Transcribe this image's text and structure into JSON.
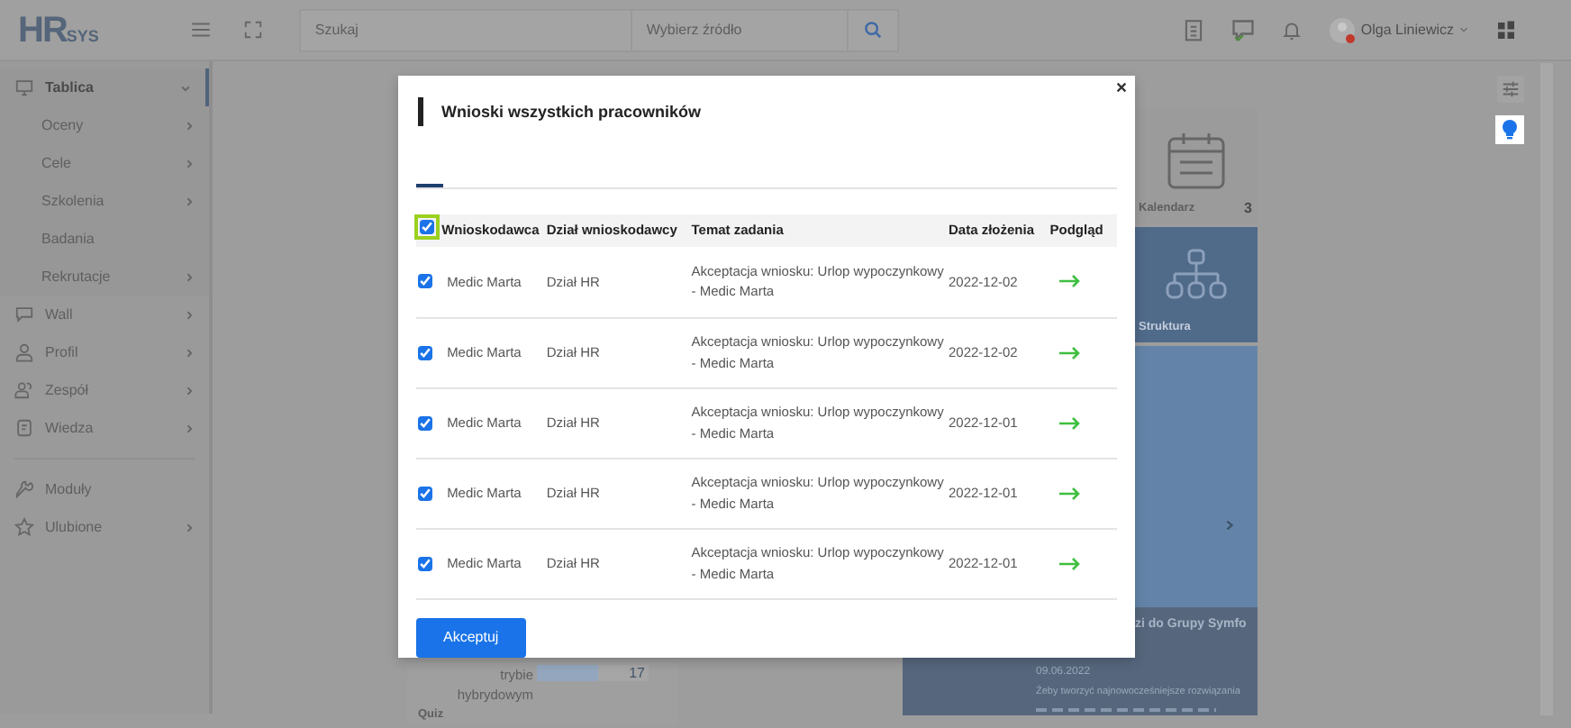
{
  "header": {
    "logo_letters": "HR",
    "logo_suffix": "SYS",
    "search_placeholder": "Szukaj",
    "source_placeholder": "Wybierz źródło",
    "user_name": "Olga Liniewicz"
  },
  "sidebar": {
    "items": [
      {
        "label": "Tablica",
        "selected": true,
        "has_submenu": true,
        "expanded": true,
        "children": [
          {
            "label": "Oceny",
            "has_submenu": true
          },
          {
            "label": "Cele",
            "has_submenu": true
          },
          {
            "label": "Szkolenia",
            "has_submenu": true
          },
          {
            "label": "Badania",
            "has_submenu": false
          },
          {
            "label": "Rekrutacje",
            "has_submenu": true
          }
        ]
      },
      {
        "label": "Wall",
        "selected": false,
        "has_submenu": true,
        "expanded": false
      },
      {
        "label": "Profil",
        "selected": false,
        "has_submenu": true,
        "expanded": false
      },
      {
        "label": "Zespół",
        "selected": false,
        "has_submenu": true,
        "expanded": false
      },
      {
        "label": "Wiedza",
        "selected": false,
        "has_submenu": true,
        "expanded": false
      },
      {
        "label": "Moduły",
        "selected": false,
        "has_submenu": false
      },
      {
        "label": "Ulubione",
        "selected": false,
        "has_submenu": true,
        "expanded": false
      }
    ]
  },
  "stats_card": {
    "label_lines": [
      "trybie",
      "hybrydowym"
    ],
    "value": "17",
    "level": 0.55,
    "footer": "Quiz"
  },
  "tiles": [
    {
      "kind": "calendar",
      "label": "Kalendarz",
      "count": "3"
    },
    {
      "kind": "structure",
      "label": "Struktura"
    }
  ],
  "slide": {
    "title": "zi do Grupy Symfo",
    "date": "09.06.2022",
    "text": "Żeby tworzyć najnowocześniejsze rozwiązania"
  },
  "modal": {
    "title": "Wnioski wszystkich pracowników",
    "tabs": [
      {
        "selected": true
      }
    ],
    "table": {
      "select_all_checked": true,
      "columns": [
        "Wnioskodawca",
        "Dział wnioskodawcy",
        "Temat zadania",
        "Data złożenia",
        "Podgląd"
      ],
      "rows": [
        {
          "checked": true,
          "applicant": "Medic Marta",
          "department": "Dział HR",
          "subject": "Akceptacja wniosku: Urlop wypoczynkowy - Medic Marta",
          "date": "2022-12-02"
        },
        {
          "checked": true,
          "applicant": "Medic Marta",
          "department": "Dział HR",
          "subject": "Akceptacja wniosku: Urlop wypoczynkowy - Medic Marta",
          "date": "2022-12-02"
        },
        {
          "checked": true,
          "applicant": "Medic Marta",
          "department": "Dział HR",
          "subject": "Akceptacja wniosku: Urlop wypoczynkowy - Medic Marta",
          "date": "2022-12-01"
        },
        {
          "checked": true,
          "applicant": "Medic Marta",
          "department": "Dział HR",
          "subject": "Akceptacja wniosku: Urlop wypoczynkowy - Medic Marta",
          "date": "2022-12-01"
        },
        {
          "checked": true,
          "applicant": "Medic Marta",
          "department": "Dział HR",
          "subject": "Akceptacja wniosku: Urlop wypoczynkowy - Medic Marta",
          "date": "2022-12-01"
        }
      ]
    },
    "accept_button": "Akceptuj"
  }
}
